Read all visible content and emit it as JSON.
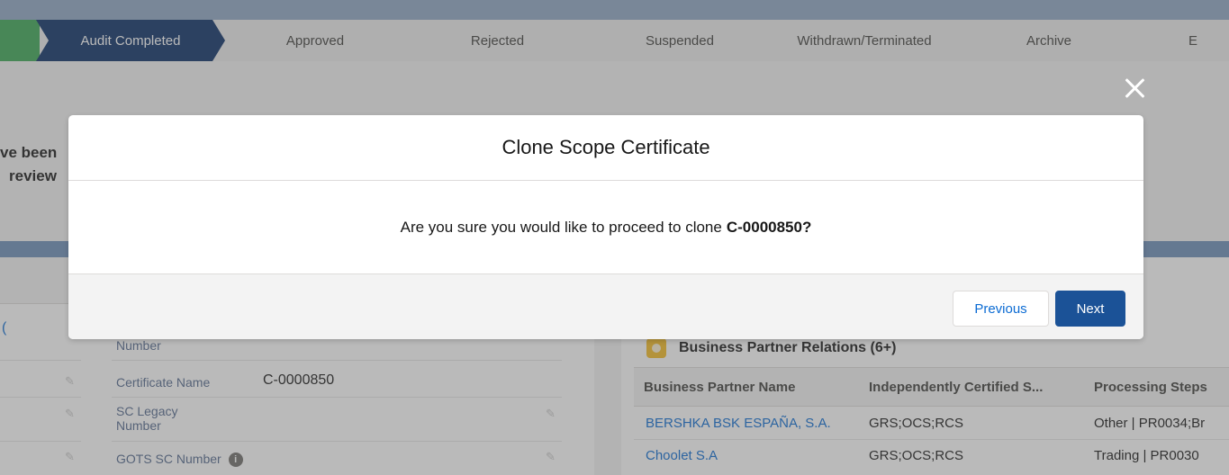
{
  "path": {
    "steps": [
      {
        "label": ""
      },
      {
        "label": "Audit Completed"
      },
      {
        "label": "Approved"
      },
      {
        "label": "Rejected"
      },
      {
        "label": "Suspended"
      },
      {
        "label": "Withdrawn/Terminated"
      },
      {
        "label": "Archive"
      },
      {
        "label": "E"
      }
    ]
  },
  "header": {
    "line1": "ve been",
    "line2": "review"
  },
  "left_panel": {
    "link_fragment": "(",
    "fields": [
      {
        "label": "Number",
        "value": ""
      },
      {
        "label": "Certificate Name",
        "value": "C-0000850"
      },
      {
        "label": "SC Legacy\nNumber",
        "value": ""
      },
      {
        "label": "GOTS SC Number",
        "value": ""
      }
    ],
    "info_glyph": "i"
  },
  "right_panel": {
    "title": "Business Partner Relations (6+)",
    "columns": [
      "Business Partner Name",
      "Independently Certified S...",
      "Processing Steps"
    ],
    "rows": [
      {
        "name": "BERSHKA BSK ESPAÑA, S.A.",
        "certified": "GRS;OCS;RCS",
        "steps": "Other | PR0034;Br"
      },
      {
        "name": "Choolet S.A",
        "certified": "GRS;OCS;RCS",
        "steps": "Trading | PR0030"
      }
    ]
  },
  "modal": {
    "title": "Clone Scope Certificate",
    "message": "Are you sure you would like to proceed to clone",
    "record": "C-0000850?",
    "previous_label": "Previous",
    "next_label": "Next",
    "close_icon": "close-icon"
  },
  "colors": {
    "path_current": "#0b2f66",
    "path_complete": "#3ba755",
    "brand_button": "#1b5297",
    "link": "#0b6bd3"
  }
}
